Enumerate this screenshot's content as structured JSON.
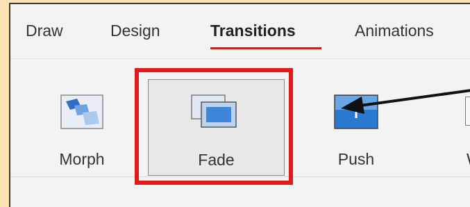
{
  "tabs": [
    {
      "label": "Draw"
    },
    {
      "label": "Design"
    },
    {
      "label": "Transitions"
    },
    {
      "label": "Animations"
    }
  ],
  "active_tab": "Transitions",
  "transitions": [
    {
      "label": "Morph",
      "icon": "morph-icon"
    },
    {
      "label": "Fade",
      "icon": "fade-icon",
      "selected": true
    },
    {
      "label": "Push",
      "icon": "push-icon"
    },
    {
      "label": "W",
      "icon": "wipe-icon"
    }
  ],
  "colors": {
    "page_background": "#fbe3b4",
    "ribbon_background": "#f3f3f3",
    "active_tab_underline": "#b8261e",
    "highlight_border": "#e01a1a",
    "icon_blue": "#2f7bd4"
  }
}
